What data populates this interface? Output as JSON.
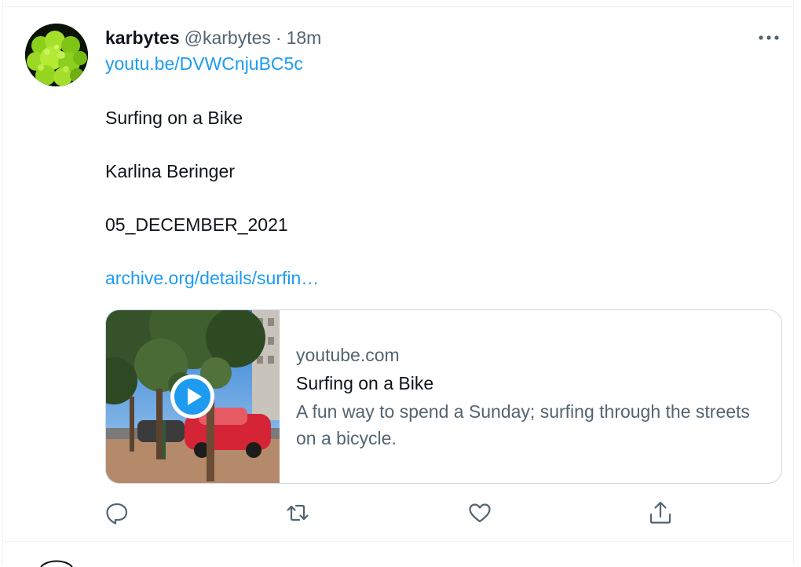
{
  "tweet": {
    "author_name": "karbytes",
    "author_handle": "@karbytes",
    "separator": "·",
    "time": "18m",
    "lines": {
      "link_youtube": "youtu.be/DVWCnjuBC5c",
      "title": "Surfing on a Bike",
      "author": "Karlina Beringer",
      "date": "05_DECEMBER_2021",
      "link_archive": "archive.org/details/surfin…"
    },
    "card": {
      "domain": "youtube.com",
      "title": "Surfing on a Bike",
      "description": "A fun way to spend a Sunday; surfing through the streets on a bicycle."
    }
  },
  "icons": {
    "more": "more-horizontal-icon",
    "reply": "reply-icon",
    "retweet": "retweet-icon",
    "like": "like-icon",
    "share": "share-icon",
    "play": "play-icon"
  },
  "colors": {
    "link": "#1d9bf0",
    "secondary_text": "#536471",
    "primary_text": "#0f1419",
    "border": "#cfd9de"
  }
}
